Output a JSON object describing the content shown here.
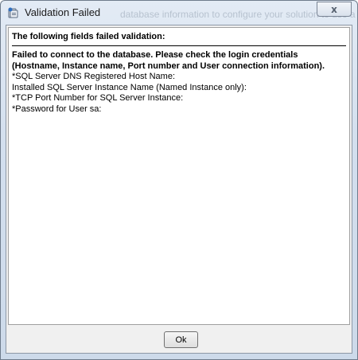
{
  "window": {
    "title": "Validation Failed",
    "background_title_text": "database information to configure your solution to use a",
    "close_label": "x"
  },
  "content": {
    "header": "The following fields failed validation:",
    "error_line1": "Failed to connect to the database. Please check the login credentials",
    "error_line2": "(Hostname, Instance name, Port number and User connection information).",
    "fields": [
      "*SQL Server DNS Registered Host Name:",
      "Installed SQL Server Instance Name (Named Instance only):",
      "*TCP Port Number for SQL Server Instance:",
      "*Password for User sa:"
    ]
  },
  "buttons": {
    "ok_label": "Ok"
  }
}
